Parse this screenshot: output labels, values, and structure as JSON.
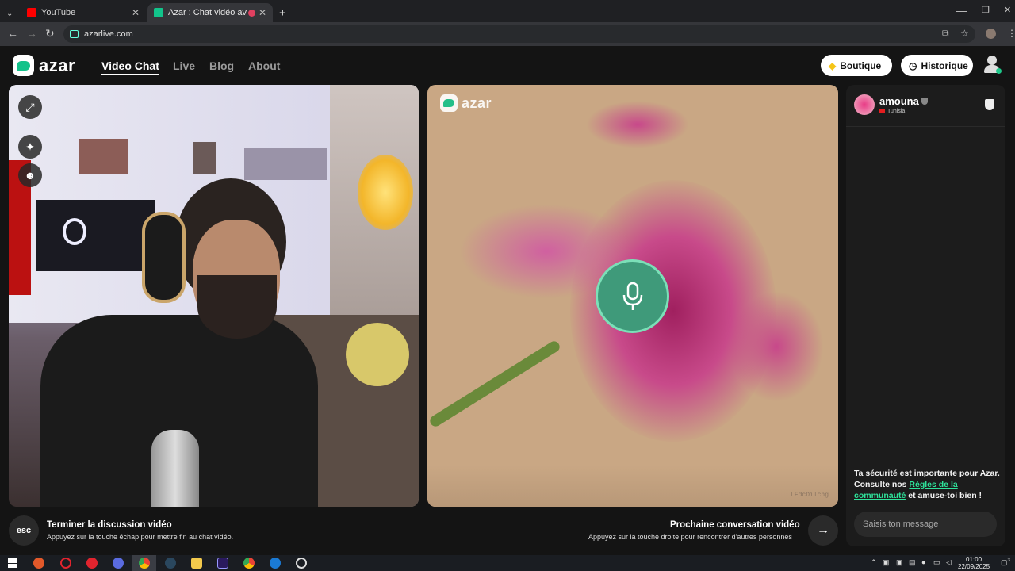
{
  "browser": {
    "tabs": [
      {
        "title": "YouTube",
        "color": "#ff0000"
      },
      {
        "title": "Azar : Chat vidéo avec de n",
        "color": "#12c48b"
      }
    ],
    "new_tab": "+",
    "url": "azarlive.com",
    "window_controls": {
      "minimize": "—",
      "maximize": "❐",
      "close": "✕"
    },
    "nav": {
      "back": "←",
      "forward": "→",
      "reload": "↻",
      "menu": "⋮",
      "star": "☆"
    }
  },
  "header": {
    "logo_text": "azar",
    "nav_items": [
      "Video Chat",
      "Live",
      "Blog",
      "About"
    ],
    "active_nav": "Video Chat",
    "boutique_label": "Boutique",
    "historique_label": "Historique",
    "boutique_icon": "diamond-icon",
    "historique_icon": "clock-icon"
  },
  "local_video": {
    "controls": [
      "expand-icon",
      "sparkle-icon",
      "face-filter-icon"
    ]
  },
  "remote_video": {
    "watermark": "azar",
    "stream_id": "LFdcDilchg",
    "mic_state": "muted-audio-only"
  },
  "chat_panel": {
    "peer_name": "amouna",
    "peer_country": "Tunisia",
    "safety_prefix": "Ta sécurité est importante pour Azar. Consulte nos ",
    "safety_link": "Règles de la communauté",
    "safety_suffix": " et amuse-toi bien !",
    "message_placeholder": "Saisis ton message"
  },
  "actions": {
    "esc_key": "esc",
    "end_title": "Terminer la discussion vidéo",
    "end_sub": "Appuyez sur la touche échap pour mettre fin au chat vidéo.",
    "next_title": "Prochaine conversation vidéo",
    "next_sub": "Appuyez sur la touche droite pour rencontrer d'autres personnes",
    "next_icon": "→"
  },
  "taskbar": {
    "time": "01:00",
    "date": "22/09/2025",
    "notifications": "3"
  },
  "colors": {
    "accent": "#12c48b",
    "link": "#2ee29a",
    "page_bg": "#141414",
    "panel_bg": "#1c1c1c"
  }
}
